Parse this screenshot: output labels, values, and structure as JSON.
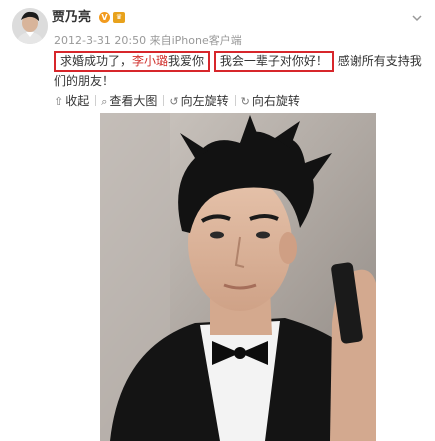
{
  "post": {
    "username": "贾乃亮",
    "verified_badge": "V",
    "meta": "2012-3-31 20:50 来自iPhone客户端",
    "text_part1": "求婚成功了，",
    "mention": "李小璐",
    "text_part2": "我爱你",
    "text_box2": "我会一辈子对你好！",
    "text_part3": "感谢所有支持我们的朋友！"
  },
  "actions": [
    {
      "icon": "arrow-up-icon",
      "glyph": "⇧",
      "label": "收起"
    },
    {
      "icon": "magnifier-icon",
      "glyph": "⌕",
      "label": "查看大图"
    },
    {
      "icon": "rotate-left-icon",
      "glyph": "↺",
      "label": "向左旋转"
    },
    {
      "icon": "rotate-right-icon",
      "glyph": "↻",
      "label": "向右旋转"
    }
  ],
  "colors": {
    "highlight_box": "#d7262b",
    "mention": "#d0312d",
    "meta_text": "#999999"
  }
}
